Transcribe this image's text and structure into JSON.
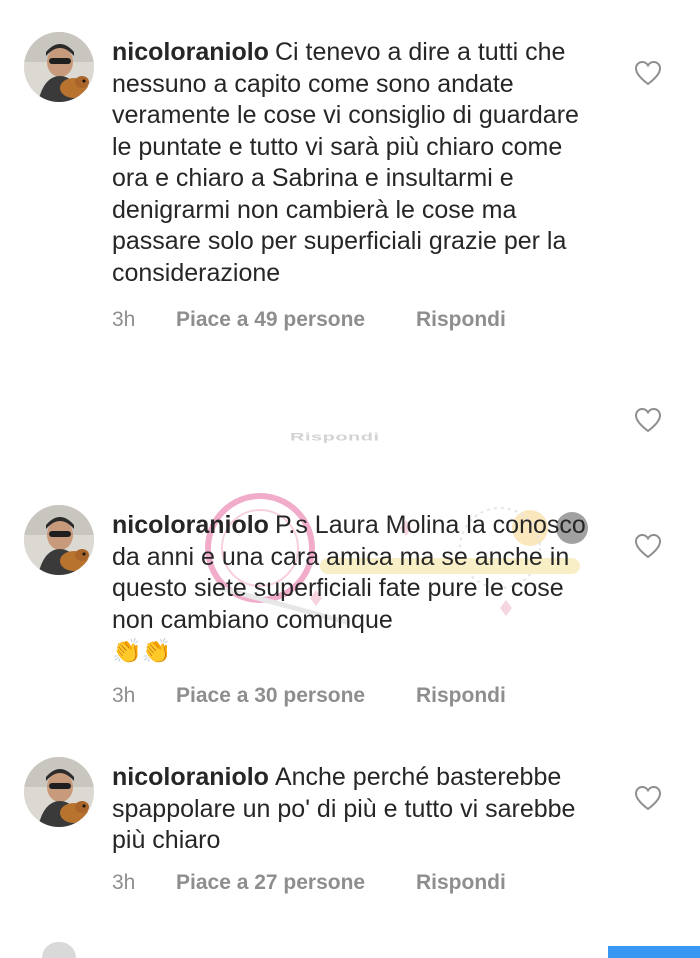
{
  "comments": [
    {
      "username": "nicoloraniolo",
      "text": "Ci tenevo a dire a tutti che nessuno a capito come sono andate veramente le cose vi consiglio di guardare le puntate e tutto vi sarà più chiaro come ora e chiaro a Sabrina e insultarmi e denigrarmi non cambierà le cose ma passare solo per superficiali grazie per la considerazione",
      "time": "3h",
      "likes": "Piace a 49 persone",
      "reply": "Rispondi"
    },
    {
      "username": "nicoloraniolo",
      "text": "P.s Laura Molina la conosco da anni e una cara amica ma se anche in questo siete superficiali fate pure le cose non cambiano comunque",
      "emoji": "👏👏",
      "time": "3h",
      "likes": "Piace a 30 persone",
      "reply": "Rispondi"
    },
    {
      "username": "nicoloraniolo",
      "text": "Anche perché basterebbe spappolare un po' di più e tutto vi sarebbe più chiaro",
      "time": "3h",
      "likes": "Piace a 27 persone",
      "reply": "Rispondi"
    }
  ],
  "ghost_reply": "Rispondi",
  "icons": {
    "like": "heart-outline-icon",
    "avatar": "profile-avatar"
  },
  "colors": {
    "text": "#262626",
    "meta": "#8e8e8e",
    "accent": "#3897f0"
  }
}
